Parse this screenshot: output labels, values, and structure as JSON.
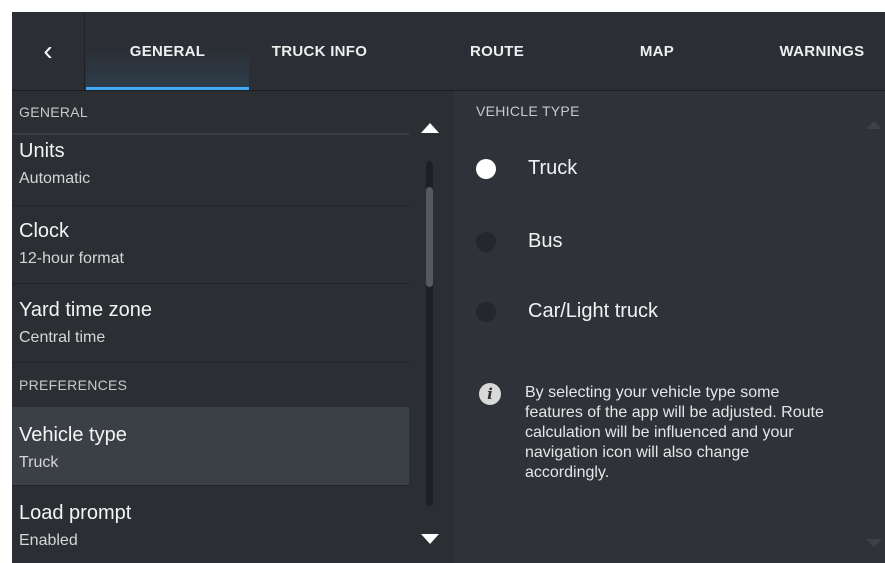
{
  "tabbar": {
    "back_glyph": "‹",
    "tabs": [
      {
        "label": "GENERAL",
        "active": true
      },
      {
        "label": "TRUCK INFO",
        "active": false
      },
      {
        "label": "ROUTE",
        "active": false
      },
      {
        "label": "MAP",
        "active": false
      },
      {
        "label": "WARNINGS",
        "active": false
      }
    ]
  },
  "left": {
    "sections": [
      {
        "header": "GENERAL"
      },
      {
        "header": "PREFERENCES"
      }
    ],
    "items": [
      {
        "title": "Units",
        "value": "Automatic"
      },
      {
        "title": "Clock",
        "value": "12-hour format"
      },
      {
        "title": "Yard time zone",
        "value": "Central time"
      },
      {
        "title": "Vehicle type",
        "value": "Truck",
        "selected": true
      },
      {
        "title": "Load prompt",
        "value": "Enabled"
      }
    ]
  },
  "right": {
    "header": "VEHICLE TYPE",
    "options": [
      {
        "label": "Truck",
        "checked": true
      },
      {
        "label": "Bus",
        "checked": false
      },
      {
        "label": "Car/Light truck",
        "checked": false
      }
    ],
    "info_icon": "i",
    "info_text": "By selecting your vehicle type some features of the app will be adjusted. Route calculation will be influenced and your navigation icon will also change accordingly."
  },
  "colors": {
    "accent": "#3fa9f5",
    "background": "#26292e",
    "selected_row": "#3b3f46"
  }
}
